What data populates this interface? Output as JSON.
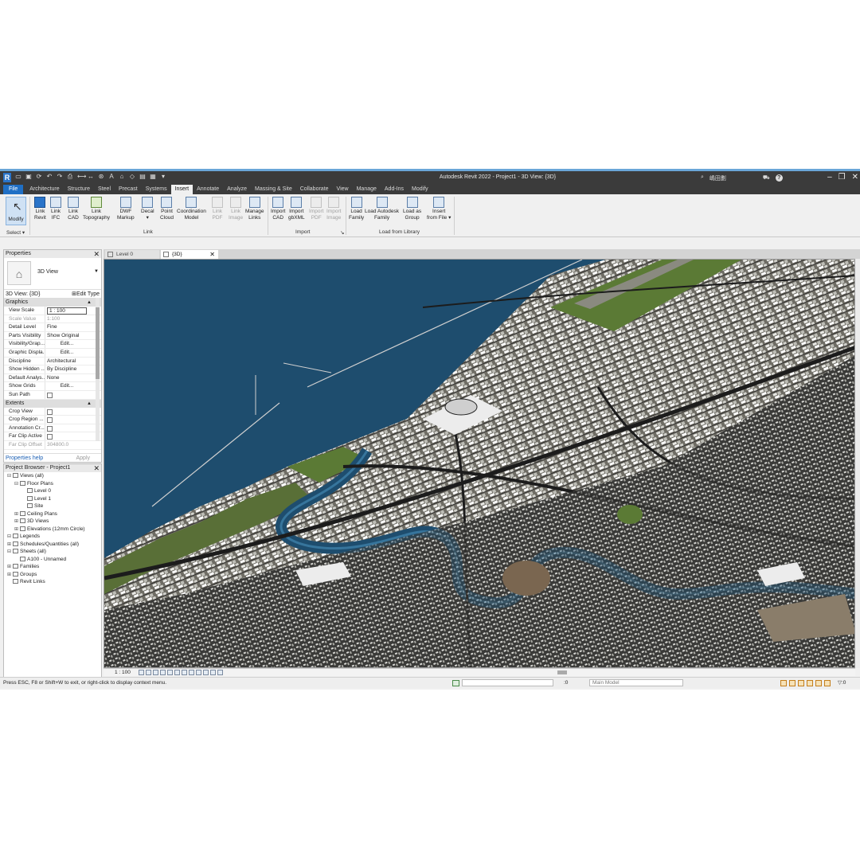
{
  "app": {
    "title": "Autodesk Revit 2022 - Project1 - 3D View: {3D}",
    "user": "嶋田劃"
  },
  "tabs": [
    "File",
    "Architecture",
    "Structure",
    "Steel",
    "Precast",
    "Systems",
    "Insert",
    "Annotate",
    "Analyze",
    "Massing & Site",
    "Collaborate",
    "View",
    "Manage",
    "Add-Ins",
    "Modify"
  ],
  "active_tab": "Insert",
  "ribbon": {
    "modify": "Modify",
    "select": "Select ▾",
    "link": [
      {
        "l1": "Link",
        "l2": "Revit"
      },
      {
        "l1": "Link",
        "l2": "IFC"
      },
      {
        "l1": "Link",
        "l2": "CAD"
      },
      {
        "l1": "Link",
        "l2": "Topography"
      },
      {
        "l1": "DWF",
        "l2": "Markup"
      },
      {
        "l1": "Decal",
        "l2": "▾"
      },
      {
        "l1": "Point",
        "l2": "Cloud"
      },
      {
        "l1": "Coordination",
        "l2": "Model"
      },
      {
        "l1": "Link",
        "l2": "PDF"
      },
      {
        "l1": "Link",
        "l2": "Image"
      },
      {
        "l1": "Manage",
        "l2": "Links"
      }
    ],
    "import": [
      {
        "l1": "Import",
        "l2": "CAD"
      },
      {
        "l1": "Import",
        "l2": "gbXML"
      },
      {
        "l1": "Import",
        "l2": "PDF"
      },
      {
        "l1": "Import",
        "l2": "Image"
      }
    ],
    "library": [
      {
        "l1": "Load",
        "l2": "Family"
      },
      {
        "l1": "Load Autodesk",
        "l2": "Family"
      },
      {
        "l1": "Load as",
        "l2": "Group"
      },
      {
        "l1": "Insert",
        "l2": "from File ▾"
      }
    ],
    "panel_link": "Link",
    "panel_import": "Import",
    "panel_import_arrow": "↘",
    "panel_library": "Load from Library"
  },
  "properties": {
    "title": "Properties",
    "type_name": "3D View",
    "instance": "3D View: {3D}",
    "edit_type": "Edit Type",
    "group_graphics": "Graphics",
    "rows_graphics": [
      {
        "k": "View Scale",
        "v": "1 : 100"
      },
      {
        "k": "Scale Value",
        "v": "1:100"
      },
      {
        "k": "Detail Level",
        "v": "Fine"
      },
      {
        "k": "Parts Visibility",
        "v": "Show Original"
      },
      {
        "k": "Visibility/Grap...",
        "v": "Edit..."
      },
      {
        "k": "Graphic Displa...",
        "v": "Edit..."
      },
      {
        "k": "Discipline",
        "v": "Architectural"
      },
      {
        "k": "Show Hidden ...",
        "v": "By Discipline"
      },
      {
        "k": "Default Analys...",
        "v": "None"
      },
      {
        "k": "Show Grids",
        "v": "Edit..."
      },
      {
        "k": "Sun Path",
        "v": ""
      }
    ],
    "group_extents": "Extents",
    "rows_extents": [
      {
        "k": "Crop View",
        "v": ""
      },
      {
        "k": "Crop Region ...",
        "v": ""
      },
      {
        "k": "Annotation Cr...",
        "v": ""
      },
      {
        "k": "Far Clip Active",
        "v": ""
      },
      {
        "k": "Far Clip Offset",
        "v": "304800.0"
      }
    ],
    "help": "Properties help",
    "apply": "Apply"
  },
  "browser": {
    "title": "Project Browser - Project1",
    "items": [
      {
        "t": "Views (all)",
        "d": 0,
        "g": "⊟"
      },
      {
        "t": "Floor Plans",
        "d": 1,
        "g": "⊟"
      },
      {
        "t": "Level 0",
        "d": 2,
        "g": ""
      },
      {
        "t": "Level 1",
        "d": 2,
        "g": ""
      },
      {
        "t": "Site",
        "d": 2,
        "g": ""
      },
      {
        "t": "Ceiling Plans",
        "d": 1,
        "g": "⊞"
      },
      {
        "t": "3D Views",
        "d": 1,
        "g": "⊞"
      },
      {
        "t": "Elevations (12mm Circle)",
        "d": 1,
        "g": "⊞"
      },
      {
        "t": "Legends",
        "d": 0,
        "g": "⊟"
      },
      {
        "t": "Schedules/Quantities (all)",
        "d": 0,
        "g": "⊞"
      },
      {
        "t": "Sheets (all)",
        "d": 0,
        "g": "⊟"
      },
      {
        "t": "A100 - Unnamed",
        "d": 1,
        "g": ""
      },
      {
        "t": "Families",
        "d": 0,
        "g": "⊞"
      },
      {
        "t": "Groups",
        "d": 0,
        "g": "⊞"
      },
      {
        "t": "Revit Links",
        "d": 0,
        "g": ""
      }
    ]
  },
  "view_tabs": {
    "tab1": "Level 0",
    "tab2": "{3D}"
  },
  "view_control": {
    "scale": "1 : 100"
  },
  "status": {
    "message": "Press ESC, F8 or Shift+W to exit, or right-click to display context menu.",
    "zero": ":0",
    "model": "Main Model",
    "filter": "▽:0"
  },
  "colors": {
    "water": "#1e4d6e",
    "land": "#7d7b70",
    "green": "#5b7a35",
    "accent": "#1f6fc5"
  }
}
